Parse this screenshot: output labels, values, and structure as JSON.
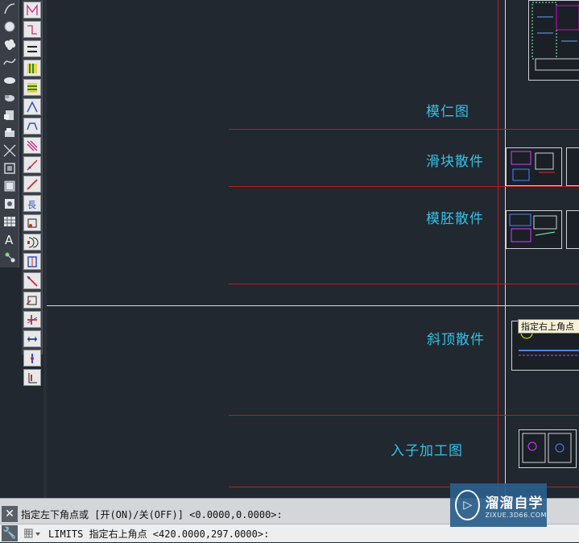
{
  "drawing": {
    "labels": [
      {
        "key": "mold-core",
        "text": "模仁图"
      },
      {
        "key": "slider-parts",
        "text": "滑块散件"
      },
      {
        "key": "mold-base-parts",
        "text": "模胚散件"
      },
      {
        "key": "lifter-parts",
        "text": "斜顶散件"
      },
      {
        "key": "insert-machining",
        "text": "入子加工图"
      }
    ],
    "tooltip": "指定右上角点"
  },
  "toolbars": {
    "draw_icons": [
      "polyline-icon",
      "circle-icon",
      "revision-cloud-icon",
      "spline-icon",
      "ellipse-icon",
      "ellipse-arc-icon",
      "insert-block-icon",
      "make-block-icon",
      "construction-line-icon",
      "region-icon",
      "table-icon",
      "hatch-icon",
      "gradient-icon",
      "multiline-text-icon",
      "add-point-icon"
    ],
    "modify_icons": [
      "dimension-linear-icon",
      "dimension-aligned-icon",
      "dimension-arc-icon",
      "dimension-ordinate-icon",
      "dimension-radius-icon",
      "dimension-jogged-icon",
      "dimension-diameter-icon",
      "dimension-angular-icon",
      "quick-dimension-icon",
      "baseline-dimension-icon",
      "continue-dimension-icon",
      "dimension-space-icon",
      "dimension-break-icon",
      "tolerance-icon",
      "center-mark-icon",
      "inspection-icon",
      "jogged-linear-icon",
      "dimension-edit-icon",
      "dimension-text-edit-icon",
      "dimension-update-icon"
    ]
  },
  "command_line": {
    "history": "指定左下角点或 [开(ON)/关(OFF)] <0.0000,0.0000>:",
    "prompt": "LIMITS 指定右上角点 <420.0000,297.0000>:"
  },
  "watermark": {
    "title": "溜溜自学",
    "url": "ZIXUE.3D66.COM"
  },
  "colors": {
    "canvas": "#212830",
    "label": "#35c0e6",
    "boundary": "#c01a1a"
  }
}
